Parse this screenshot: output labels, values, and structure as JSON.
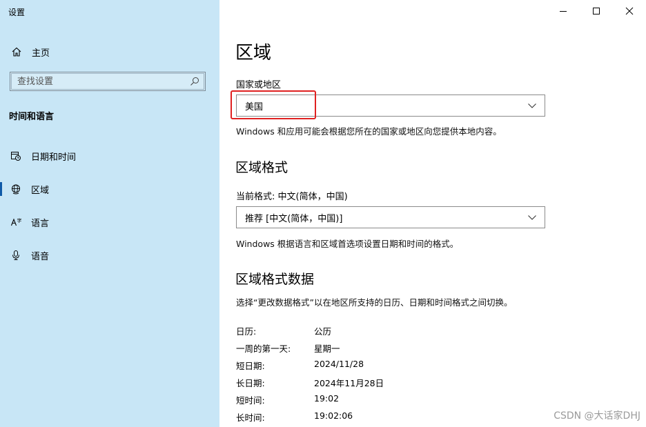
{
  "app": {
    "title": "设置"
  },
  "sidebar": {
    "home_label": "主页",
    "search_placeholder": "查找设置",
    "section_title": "时间和语言",
    "items": [
      {
        "label": "日期和时间",
        "icon": "calendar-clock-icon",
        "active": false
      },
      {
        "label": "区域",
        "icon": "globe-icon",
        "active": true
      },
      {
        "label": "语言",
        "icon": "language-icon",
        "active": false
      },
      {
        "label": "语音",
        "icon": "microphone-icon",
        "active": false
      }
    ]
  },
  "window_controls": [
    "minimize",
    "maximize",
    "close"
  ],
  "main": {
    "title": "区域",
    "country": {
      "label": "国家或地区",
      "value": "美国",
      "description": "Windows 和应用可能会根据您所在的国家或地区向您提供本地内容。"
    },
    "format": {
      "heading": "区域格式",
      "current_label": "当前格式: 中文(简体，中国)",
      "value": "推荐 [中文(简体，中国)]",
      "description": "Windows 根据语言和区域首选项设置日期和时间的格式。"
    },
    "format_data": {
      "heading": "区域格式数据",
      "description": "选择“更改数据格式”以在地区所支持的日历、日期和时间格式之间切换。",
      "rows": [
        {
          "key": "日历:",
          "value": "公历"
        },
        {
          "key": "一周的第一天:",
          "value": "星期一"
        },
        {
          "key": "短日期:",
          "value": "2024/11/28"
        },
        {
          "key": "长日期:",
          "value": "2024年11月28日"
        },
        {
          "key": "短时间:",
          "value": "19:02"
        },
        {
          "key": "长时间:",
          "value": "19:02:06"
        }
      ]
    }
  },
  "watermark": "CSDN @大话家DHJ",
  "colors": {
    "sidebar_bg": "#c8e6f6",
    "accent": "#0f5aa8",
    "highlight": "#e02020"
  }
}
